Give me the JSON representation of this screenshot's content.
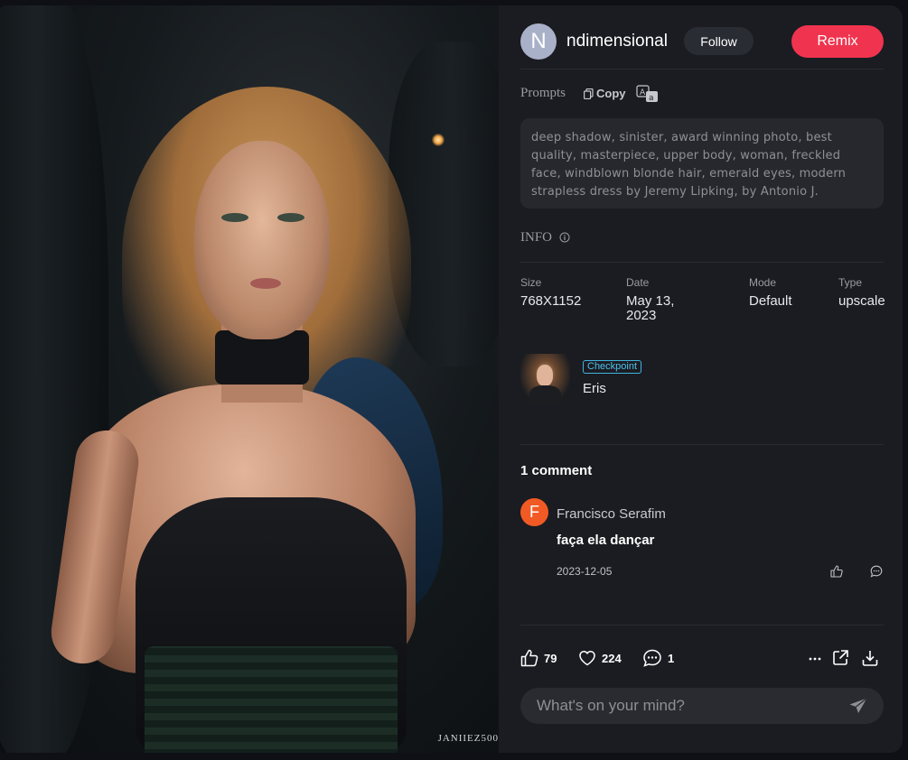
{
  "image": {
    "watermark": "JANIIEZ500"
  },
  "author": {
    "avatar_letter": "N",
    "name": "ndimensional",
    "follow_label": "Follow"
  },
  "remix_label": "Remix",
  "prompts": {
    "title": "Prompts",
    "copy_label": "Copy",
    "text": "deep shadow, sinister, award winning photo, best quality, masterpiece, upper body, woman, freckled face, windblown blonde hair, emerald eyes, modern strapless dress by Jeremy Lipking, by Antonio J."
  },
  "info": {
    "title": "INFO",
    "size_label": "Size",
    "size_value": "768X1152",
    "date_label": "Date",
    "date_value": "May 13, 2023",
    "mode_label": "Mode",
    "mode_value": "Default",
    "type_label": "Type",
    "type_value": "upscale"
  },
  "checkpoint": {
    "badge": "Checkpoint",
    "name": "Eris"
  },
  "comments": {
    "count_label": "1 comment",
    "items": [
      {
        "avatar_letter": "F",
        "author": "Francisco Serafim",
        "text": "faça ela dançar",
        "date": "2023-12-05"
      }
    ]
  },
  "actions": {
    "likes": "79",
    "hearts": "224",
    "comments": "1"
  },
  "compose": {
    "placeholder": "What's on your mind?"
  },
  "colors": {
    "accent": "#f0344f",
    "panel": "#1b1c21",
    "badge": "#3fb4e0"
  }
}
